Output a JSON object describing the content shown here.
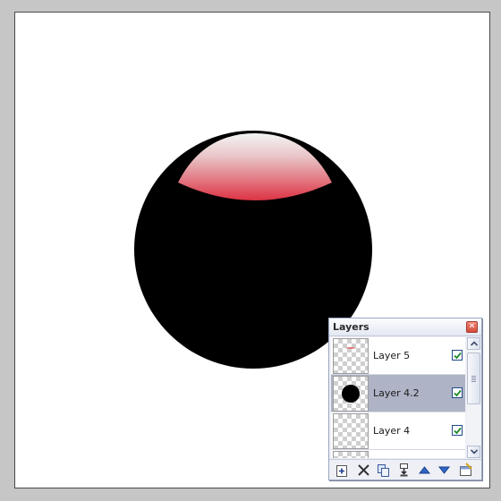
{
  "canvas": {
    "background": "#ffffff",
    "ball_color": "#000000",
    "highlight_top": "#ffffff",
    "highlight_bottom": "#dd3344"
  },
  "layers_panel": {
    "title": "Layers",
    "close_icon": "close-icon",
    "layers": [
      {
        "name": "Layer 5",
        "visible": true,
        "selected": false,
        "thumb": "red-highlight-thumbnail"
      },
      {
        "name": "Layer 4.2",
        "visible": true,
        "selected": true,
        "thumb": "black-circle-thumbnail"
      },
      {
        "name": "Layer 4",
        "visible": true,
        "selected": false,
        "thumb": "transparent-thumbnail"
      }
    ],
    "toolbar_icons": [
      "add-layer-icon",
      "delete-layer-icon",
      "duplicate-layer-icon",
      "merge-down-icon",
      "move-layer-up-icon",
      "move-layer-down-icon",
      "layer-properties-icon"
    ]
  }
}
